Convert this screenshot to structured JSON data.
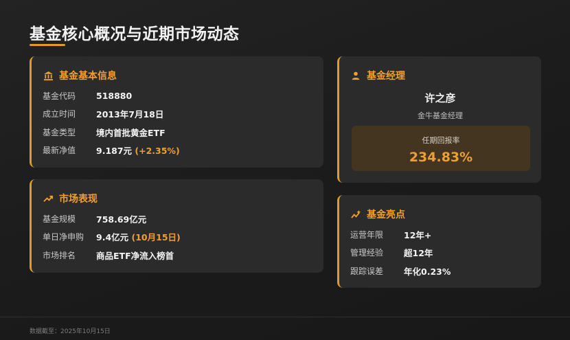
{
  "page": {
    "title": "基金核心概况与近期市场动态"
  },
  "basic_info": {
    "heading": "基金基本信息",
    "icon": "bank-icon",
    "rows": [
      {
        "label": "基金代码",
        "value": "518880"
      },
      {
        "label": "成立时间",
        "value": "2013年7月18日"
      },
      {
        "label": "基金类型",
        "value": "境内首批黄金ETF"
      },
      {
        "label": "最新净值",
        "value": "9.187元",
        "highlight": "(+2.35%)"
      }
    ]
  },
  "market": {
    "heading": "市场表现",
    "icon": "trend-up-icon",
    "rows": [
      {
        "label": "基金规模",
        "value": "758.69亿元"
      },
      {
        "label": "单日净申购",
        "value": "9.4亿元",
        "highlight": "(10月15日)"
      },
      {
        "label": "市场排名",
        "value": "商品ETF净流入榜首"
      }
    ]
  },
  "manager": {
    "heading": "基金经理",
    "icon": "user-icon",
    "name": "许之彦",
    "company": "金牛基金经理",
    "return_label": "任期回报率",
    "return_value": "234.83%"
  },
  "highlights": {
    "heading": "基金亮点",
    "icon": "sparkle-chart-icon",
    "rows": [
      {
        "label": "运营年限",
        "value": "12年+"
      },
      {
        "label": "管理经验",
        "value": "超12年"
      },
      {
        "label": "跟踪误差",
        "value": "年化0.23%"
      }
    ]
  },
  "footer": {
    "text": "数据截至：2025年10月15日"
  },
  "colors": {
    "accent": "#e39a26",
    "accent_text": "#f0a032",
    "card_bg": "#2b2b2b"
  }
}
